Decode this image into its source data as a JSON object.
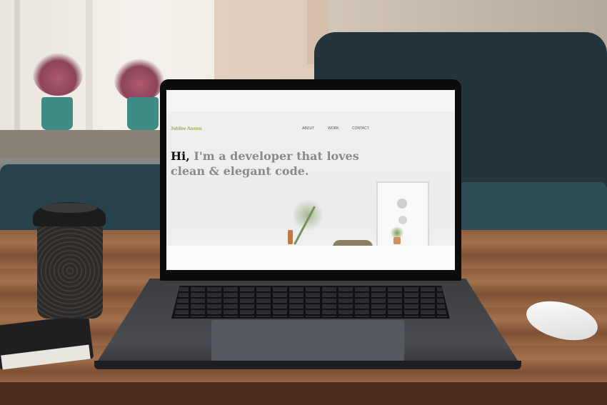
{
  "website": {
    "logo": "Jubilee Austen",
    "nav": [
      "ABOUT",
      "WORK",
      "CONTACT"
    ],
    "headline_hi": "Hi,",
    "headline_rest": " I'm a developer that loves clean & elegant code."
  },
  "colors": {
    "logo_accent": "#a3b33a",
    "headline_emphasis": "#111111",
    "headline_text": "#8a8a8a"
  }
}
